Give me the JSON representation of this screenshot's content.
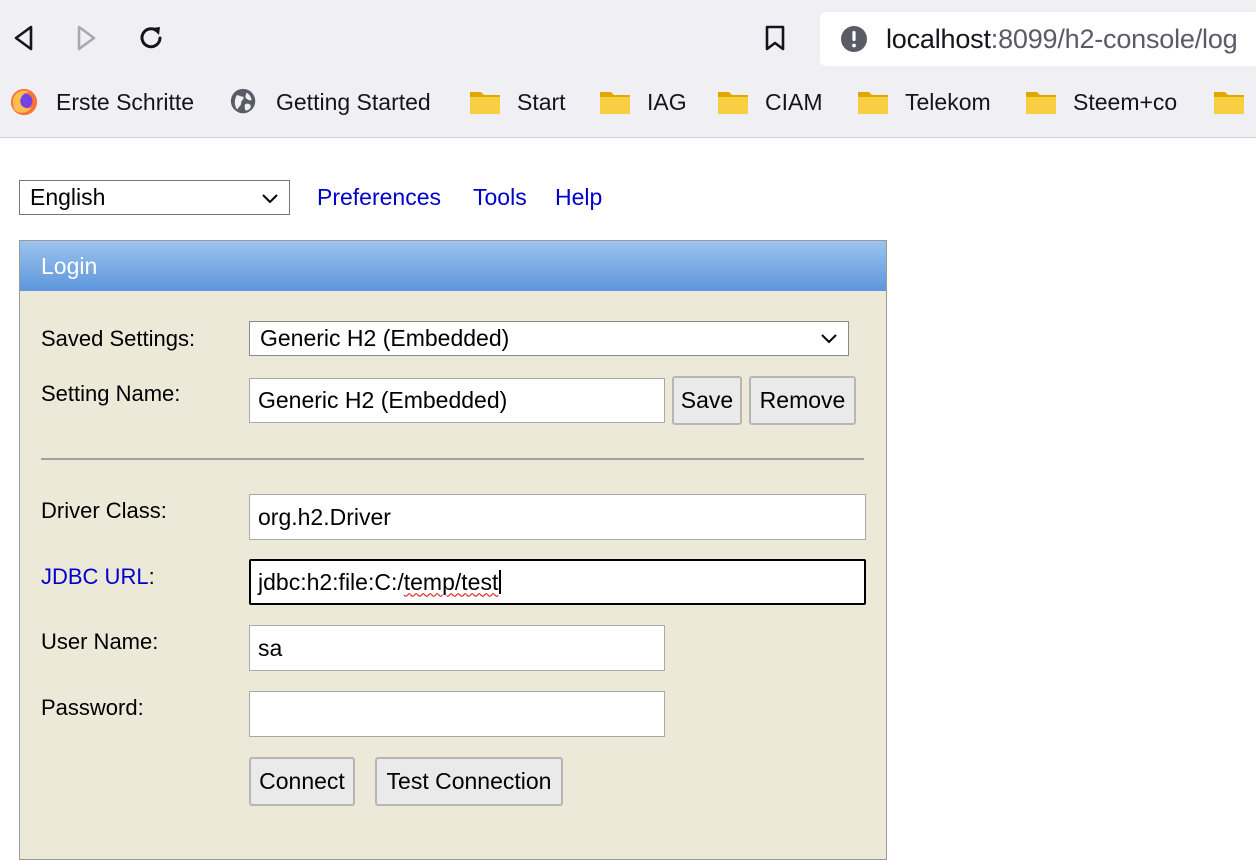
{
  "browser": {
    "url_host": "localhost",
    "url_rest": ":8099/h2-console/log",
    "bookmarks": [
      {
        "label": "Erste Schritte",
        "icon": "firefox-icon"
      },
      {
        "label": "Getting Started",
        "icon": "globe-icon"
      },
      {
        "label": "Start",
        "icon": "folder-icon"
      },
      {
        "label": "IAG",
        "icon": "folder-icon"
      },
      {
        "label": "CIAM",
        "icon": "folder-icon"
      },
      {
        "label": "Telekom",
        "icon": "folder-icon"
      },
      {
        "label": "Steem+co",
        "icon": "folder-icon"
      }
    ]
  },
  "topbar": {
    "language": "English",
    "links": {
      "preferences": "Preferences",
      "tools": "Tools",
      "help": "Help"
    }
  },
  "login": {
    "title": "Login",
    "saved_settings_label": "Saved Settings:",
    "saved_settings_value": "Generic H2 (Embedded)",
    "setting_name_label": "Setting Name:",
    "setting_name_value": "Generic H2 (Embedded)",
    "save_label": "Save",
    "remove_label": "Remove",
    "driver_class_label": "Driver Class:",
    "driver_class_value": "org.h2.Driver",
    "jdbc_url_link": "JDBC URL",
    "jdbc_url_colon": ":",
    "jdbc_url_value_prefix": "jdbc:h2:file:C:/",
    "jdbc_url_value_misspelled": "temp/test",
    "user_name_label": "User Name:",
    "user_name_value": "sa",
    "password_label": "Password:",
    "password_value": "",
    "connect_label": "Connect",
    "test_connection_label": "Test Connection"
  },
  "colors": {
    "link": "#0000cc",
    "panel_bg": "#ece9d8",
    "header_top": "#9cc4ee",
    "header_bottom": "#5d95dc"
  }
}
